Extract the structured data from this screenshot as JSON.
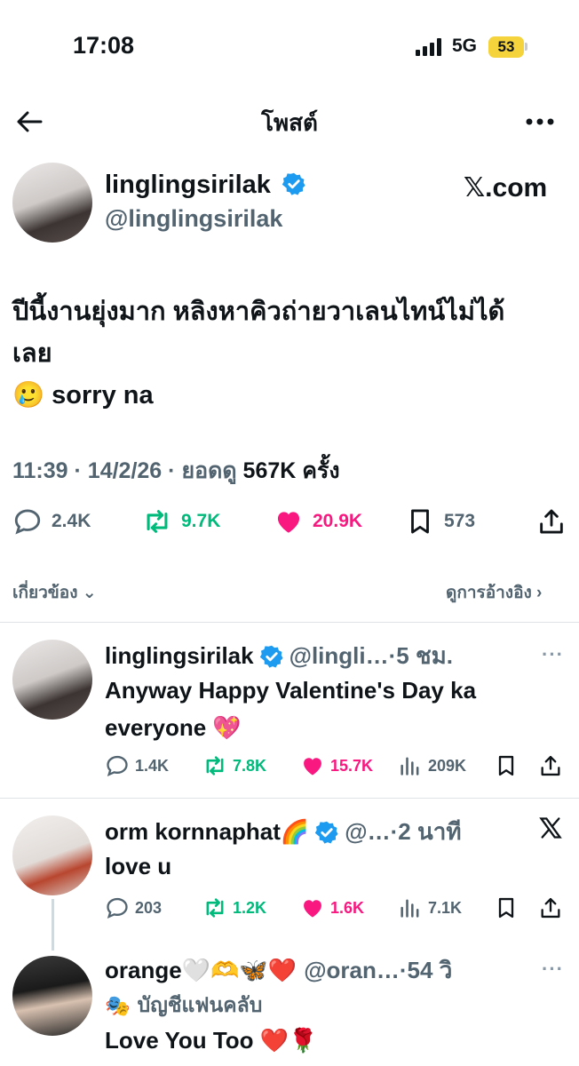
{
  "status_bar": {
    "time": "17:08",
    "network": "5G",
    "battery": "53"
  },
  "header": {
    "title": "โพสต์"
  },
  "main_post": {
    "author_name": "linglingsirilak",
    "author_handle": "@linglingsirilak",
    "brand": "𝕏.com",
    "text_line1": "ปีนี้งานยุ่งมาก หลิงหาคิวถ่ายวาเลนไทน์ไม่ได้",
    "text_line2": "เลย",
    "text_line3": "🥲 sorry na",
    "time": "11:39",
    "date": "14/2/26",
    "views_label": "ยอดดู",
    "views": "567K",
    "views_suffix": "ครั้ง",
    "replies": "2.4K",
    "reposts": "9.7K",
    "likes": "20.9K",
    "bookmarks": "573"
  },
  "related_label": "เกี่ยวข้อง",
  "quotes_label": "ดูการอ้างอิง",
  "replies": [
    {
      "name": "linglingsirilak",
      "handle": "@lingli…",
      "age": "·5 ชม.",
      "text_line1": "Anyway Happy Valentine's Day ka",
      "text_line2": "everyone 💖",
      "replies": "1.4K",
      "reposts": "7.8K",
      "likes": "15.7K",
      "views": "209K"
    },
    {
      "name": "orm kornnaphat🌈",
      "handle": "@…",
      "age": "·2 นาที",
      "text_line1": "love u",
      "replies": "203",
      "reposts": "1.2K",
      "likes": "1.6K",
      "views": "7.1K"
    },
    {
      "name": "orange🤍🫶🦋❤️",
      "handle": "@oran…",
      "age": "·54 วิ",
      "badge": "บัญชีแฟนคลับ",
      "text_line1": "Love You  Too ❤️🌹"
    }
  ],
  "colors": {
    "repost": "#00ba7c",
    "like": "#f91880",
    "verified": "#1d9bf0",
    "battery": "#f5d33d"
  }
}
